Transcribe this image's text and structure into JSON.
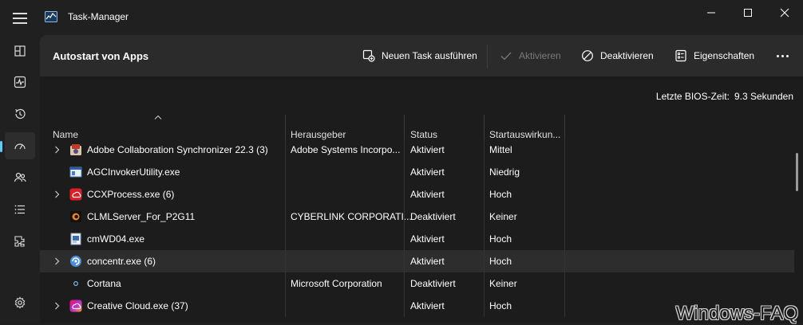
{
  "window": {
    "title": "Task-Manager"
  },
  "sidebar": {
    "items": [
      {
        "icon": "hamburger-icon"
      },
      {
        "icon": "processes-icon"
      },
      {
        "icon": "performance-icon"
      },
      {
        "icon": "app-history-icon"
      },
      {
        "icon": "startup-apps-icon",
        "active": true
      },
      {
        "icon": "users-icon"
      },
      {
        "icon": "details-icon"
      },
      {
        "icon": "services-icon"
      },
      {
        "icon": "settings-icon"
      }
    ]
  },
  "toolbar": {
    "page_title": "Autostart von Apps",
    "run_new_task": "Neuen Task ausführen",
    "enable": "Aktivieren",
    "disable": "Deaktivieren",
    "properties": "Eigenschaften"
  },
  "bios": {
    "label": "Letzte BIOS-Zeit:",
    "value": "9.3 Sekunden"
  },
  "table": {
    "columns": {
      "name": "Name",
      "publisher": "Herausgeber",
      "status": "Status",
      "impact": "Startauswirkun..."
    },
    "rows": [
      {
        "name": "Adobe Collaboration Synchronizer 22.3 (3)",
        "publisher": "Adobe Systems Incorpo...",
        "status": "Aktiviert",
        "impact": "Mittel",
        "expandable": true,
        "icon": "adobe-sync-icon"
      },
      {
        "name": "AGCInvokerUtility.exe",
        "publisher": "",
        "status": "Aktiviert",
        "impact": "Niedrig",
        "expandable": false,
        "icon": "app-window-icon"
      },
      {
        "name": "CCXProcess.exe (6)",
        "publisher": "",
        "status": "Aktiviert",
        "impact": "Hoch",
        "expandable": true,
        "icon": "creative-cloud-red-icon"
      },
      {
        "name": "CLMLServer_For_P2G11",
        "publisher": "CYBERLINK CORPORATI...",
        "status": "Deaktiviert",
        "impact": "Keiner",
        "expandable": false,
        "icon": "cyberlink-icon"
      },
      {
        "name": "cmWD04.exe",
        "publisher": "",
        "status": "Aktiviert",
        "impact": "Hoch",
        "expandable": false,
        "icon": "exe-file-icon"
      },
      {
        "name": "concentr.exe (6)",
        "publisher": "",
        "status": "Aktiviert",
        "impact": "Hoch",
        "expandable": true,
        "icon": "citrix-icon",
        "highlighted": true
      },
      {
        "name": "Cortana",
        "publisher": "Microsoft Corporation",
        "status": "Deaktiviert",
        "impact": "Keiner",
        "expandable": false,
        "icon": "cortana-icon"
      },
      {
        "name": "Creative Cloud.exe (37)",
        "publisher": "",
        "status": "Aktiviert",
        "impact": "Hoch",
        "expandable": true,
        "icon": "creative-cloud-icon"
      }
    ]
  },
  "watermark": "Windows-FAQ",
  "colors": {
    "accent": "#60cdff",
    "background": "#1c1c1c",
    "command_bar": "#2b2b2b",
    "row_highlight": "#2d2d2d"
  }
}
